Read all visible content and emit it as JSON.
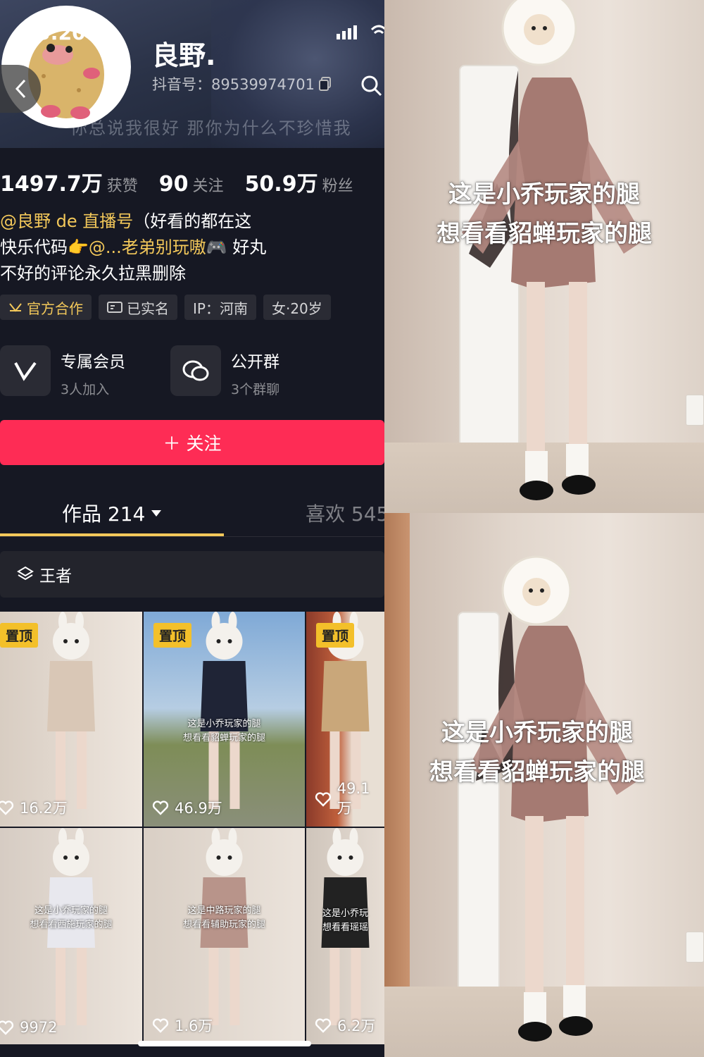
{
  "status_bar": {
    "time": "3:20"
  },
  "profile": {
    "nickname": "良野.",
    "douyin_id": "抖音号：89539974701",
    "banner_text": "你总说我很好 那你为什么不珍惜我",
    "stats": {
      "likes_value": "1497.7万",
      "likes_label": "获赞",
      "following_value": "90",
      "following_label": "关注",
      "followers_value": "50.9万",
      "followers_label": "粉丝"
    },
    "bio": {
      "line1_handle": "@良野 de 直播号",
      "line1_rest": "（好看的都在这",
      "line2_prefix": "快乐代码👉",
      "line2_handle": "@...老弟别玩嗷",
      "line2_rest": "🎮 好丸",
      "line3": "不好的评论永久拉黑删除"
    },
    "tags": [
      "官方合作",
      "已实名",
      "IP：河南",
      "女·20岁"
    ],
    "services": [
      {
        "title": "专属会员",
        "subtitle": "3人加入",
        "icon": "vip-v-icon"
      },
      {
        "title": "公开群",
        "subtitle": "3个群聊",
        "icon": "group-chat-icon"
      }
    ],
    "follow_label": "＋ 关注"
  },
  "tabs": {
    "works": "作品 214",
    "likes": "喜欢 545"
  },
  "collection": {
    "label": "王者"
  },
  "videos": [
    {
      "pinned": "置顶",
      "likes": "16.2万",
      "caption1": "",
      "caption2": ""
    },
    {
      "pinned": "置顶",
      "likes": "46.9万",
      "caption1": "这是小乔玩家的腿",
      "caption2": "想看看貂蝉玩家的腿"
    },
    {
      "pinned": "置顶",
      "likes": "49.1万",
      "caption1": "",
      "caption2": ""
    },
    {
      "pinned": "",
      "likes": "9972",
      "caption1": "这是小乔玩家的腿",
      "caption2": "想看看西施玩家的腿"
    },
    {
      "pinned": "",
      "likes": "1.6万",
      "caption1": "这是中路玩家的腿",
      "caption2": "想看看辅助玩家的腿"
    },
    {
      "pinned": "",
      "likes": "6.2万",
      "caption1": "这是小乔玩",
      "caption2": "想看看瑶瑶"
    }
  ],
  "right_panels": [
    {
      "line1": "这是小乔玩家的腿",
      "line2": "想看看貂蝉玩家的腿"
    },
    {
      "line1": "这是小乔玩家的腿",
      "line2": "想看看貂蝉玩家的腿"
    }
  ],
  "colors": {
    "accent_red": "#fe2c55",
    "gold": "#f3c85a",
    "background": "#161823"
  }
}
